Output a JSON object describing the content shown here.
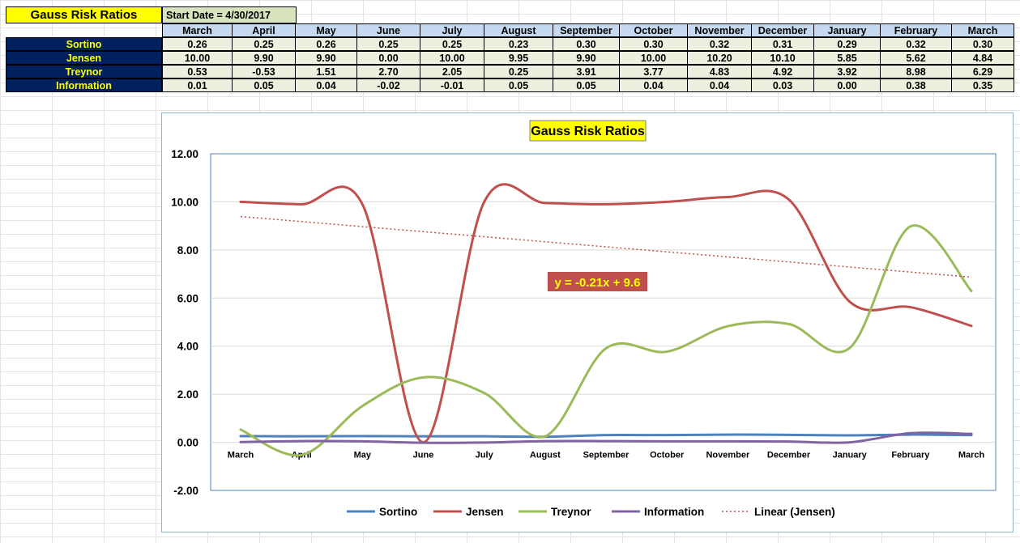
{
  "sheet": {
    "title": "Gauss Risk Ratios",
    "start_date": "Start Date = 4/30/2017",
    "months": [
      "March",
      "April",
      "May",
      "June",
      "July",
      "August",
      "September",
      "October",
      "November",
      "December",
      "January",
      "February",
      "March"
    ],
    "rows": [
      {
        "label": "Sortino",
        "values": [
          "0.26",
          "0.25",
          "0.26",
          "0.25",
          "0.25",
          "0.23",
          "0.30",
          "0.30",
          "0.32",
          "0.31",
          "0.29",
          "0.32",
          "0.30"
        ]
      },
      {
        "label": "Jensen",
        "values": [
          "10.00",
          "9.90",
          "9.90",
          "0.00",
          "10.00",
          "9.95",
          "9.90",
          "10.00",
          "10.20",
          "10.10",
          "5.85",
          "5.62",
          "4.84"
        ]
      },
      {
        "label": "Treynor",
        "values": [
          "0.53",
          "-0.53",
          "1.51",
          "2.70",
          "2.05",
          "0.25",
          "3.91",
          "3.77",
          "4.83",
          "4.92",
          "3.92",
          "8.98",
          "6.29"
        ]
      },
      {
        "label": "Information",
        "values": [
          "0.01",
          "0.05",
          "0.04",
          "-0.02",
          "-0.01",
          "0.05",
          "0.05",
          "0.04",
          "0.04",
          "0.03",
          "0.00",
          "0.38",
          "0.35"
        ]
      }
    ]
  },
  "chart_data": {
    "type": "line",
    "title": "Gauss Risk Ratios",
    "categories": [
      "March",
      "April",
      "May",
      "June",
      "July",
      "August",
      "September",
      "October",
      "November",
      "December",
      "January",
      "February",
      "March"
    ],
    "ylim": [
      -2,
      12
    ],
    "yticks": [
      "-2.00",
      "0.00",
      "2.00",
      "4.00",
      "6.00",
      "8.00",
      "10.00",
      "12.00"
    ],
    "grid": true,
    "legend": "bottom",
    "series": [
      {
        "name": "Sortino",
        "color": "#4f81bd",
        "values": [
          0.26,
          0.25,
          0.26,
          0.25,
          0.25,
          0.23,
          0.3,
          0.3,
          0.32,
          0.31,
          0.29,
          0.32,
          0.3
        ]
      },
      {
        "name": "Jensen",
        "color": "#c0504d",
        "values": [
          10.0,
          9.9,
          9.9,
          0.0,
          10.0,
          9.95,
          9.9,
          10.0,
          10.2,
          10.1,
          5.85,
          5.62,
          4.84
        ]
      },
      {
        "name": "Treynor",
        "color": "#9bbb59",
        "values": [
          0.53,
          -0.53,
          1.51,
          2.7,
          2.05,
          0.25,
          3.91,
          3.77,
          4.83,
          4.92,
          3.92,
          8.98,
          6.29
        ]
      },
      {
        "name": "Information",
        "color": "#8064a2",
        "values": [
          0.01,
          0.05,
          0.04,
          -0.02,
          -0.01,
          0.05,
          0.05,
          0.04,
          0.04,
          0.03,
          0.0,
          0.38,
          0.35
        ]
      }
    ],
    "trendline": {
      "name": "Linear (Jensen)",
      "color": "#c0504d",
      "slope": -0.21,
      "intercept": 9.6,
      "equation": "y = -0.21x + 9.6"
    }
  }
}
